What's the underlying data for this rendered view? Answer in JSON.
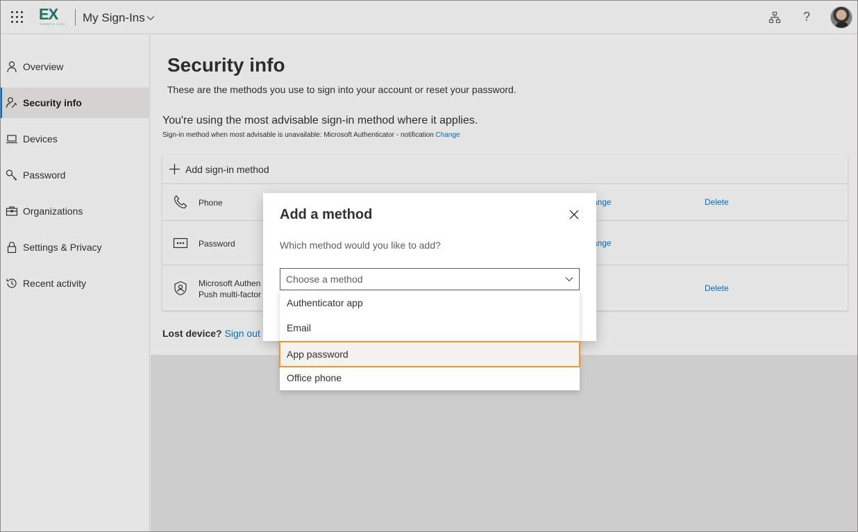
{
  "header": {
    "logo_text": "EX",
    "logo_subtext": "EXAMPLE LOGO",
    "app_title": "My Sign-Ins",
    "icons": {
      "waffle": "waffle-icon",
      "org": "org-chart-icon",
      "help": "help-icon",
      "avatar": "avatar"
    },
    "help_glyph": "?"
  },
  "sidebar": {
    "items": [
      {
        "label": "Overview",
        "icon": "person-icon",
        "active": false
      },
      {
        "label": "Security info",
        "icon": "person-key-icon",
        "active": true
      },
      {
        "label": "Devices",
        "icon": "laptop-icon",
        "active": false
      },
      {
        "label": "Password",
        "icon": "key-icon",
        "active": false
      },
      {
        "label": "Organizations",
        "icon": "briefcase-icon",
        "active": false
      },
      {
        "label": "Settings & Privacy",
        "icon": "lock-icon",
        "active": false
      },
      {
        "label": "Recent activity",
        "icon": "history-icon",
        "active": false
      }
    ]
  },
  "main": {
    "title": "Security info",
    "description": "These are the methods you use to sign into your account or reset your password.",
    "advisable": "You're using the most advisable sign-in method where it applies.",
    "advisable_sub": "Sign-in method when most advisable is unavailable: Microsoft Authenticator - notification",
    "advisable_change": "Change",
    "add_method": "Add sign-in method",
    "methods": [
      {
        "label": "Phone",
        "sub": "",
        "change": "ange",
        "delete": "Delete"
      },
      {
        "label": "Password",
        "sub": "",
        "change": "ange",
        "delete": ""
      },
      {
        "label": "Microsoft Authen",
        "sub": "Push multi-factor",
        "change": "",
        "delete": "Delete"
      }
    ],
    "lost_device": "Lost device?",
    "lost_link": "Sign out e"
  },
  "modal": {
    "title": "Add a method",
    "question": "Which method would you like to add?",
    "select_placeholder": "Choose a method",
    "options": [
      "Authenticator app",
      "Email",
      "App password",
      "Office phone"
    ],
    "highlighted_option": "App password"
  },
  "colors": {
    "accent": "#0078d4",
    "brand": "#1e7d6e",
    "highlight_outline": "#f7941d"
  }
}
